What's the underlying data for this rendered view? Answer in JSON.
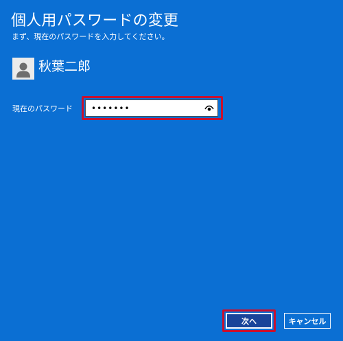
{
  "dialog": {
    "title": "個人用パスワードの変更",
    "subtitle": "まず、現在のパスワードを入力してください。"
  },
  "user": {
    "name": "秋葉二郎",
    "avatar_icon": "user-avatar-icon"
  },
  "password": {
    "label": "現在のパスワード",
    "value": "•••••••",
    "reveal_icon": "eye-icon"
  },
  "buttons": {
    "next_label": "次へ",
    "cancel_label": "キャンセル"
  },
  "colors": {
    "background": "#0b6fd3",
    "highlight": "#c8102e",
    "next_button": "#19459a"
  }
}
